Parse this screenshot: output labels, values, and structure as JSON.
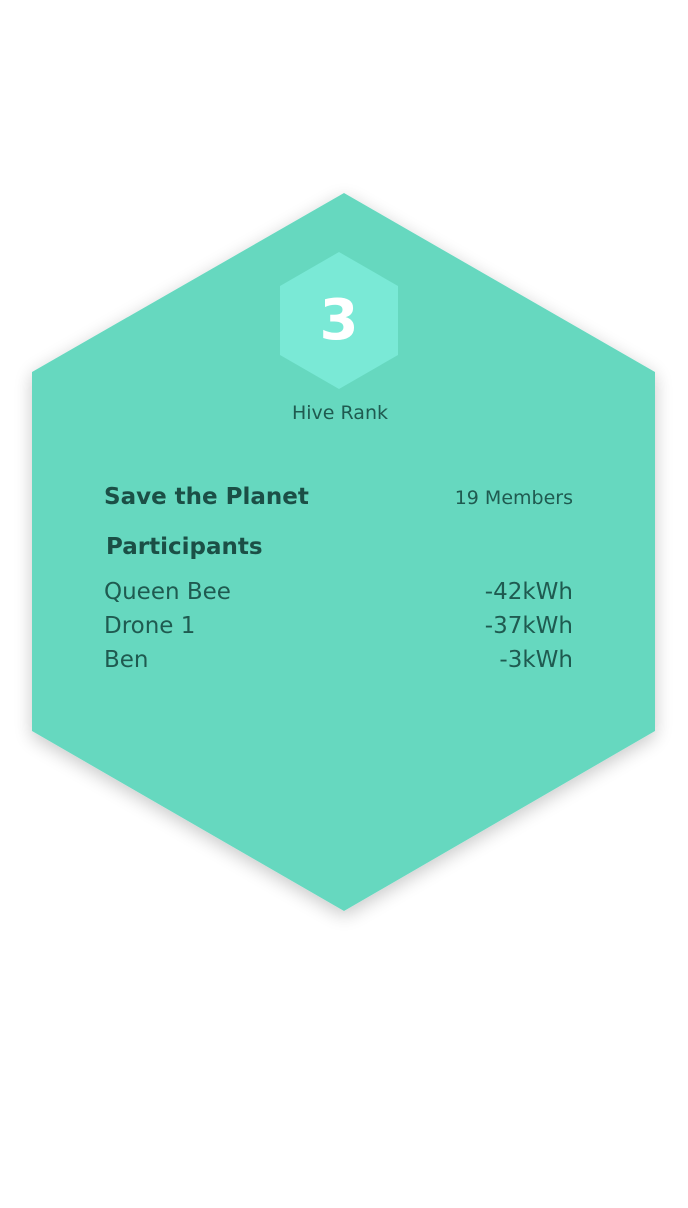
{
  "colors": {
    "hex_fill": "#66d8bf",
    "rank_badge_fill": "#7ae9d6",
    "text_dark": "#1b4f46",
    "background": "#ffffff"
  },
  "rank": {
    "number": "3",
    "label": "Hive Rank"
  },
  "team": {
    "name": "Save the Planet",
    "members": "19 Members"
  },
  "participants": {
    "heading": "Participants",
    "rows": [
      {
        "name": "Queen Bee",
        "value": "-42kWh"
      },
      {
        "name": "Drone 1",
        "value": "-37kWh"
      },
      {
        "name": "Ben",
        "value": "-3kWh"
      }
    ]
  }
}
